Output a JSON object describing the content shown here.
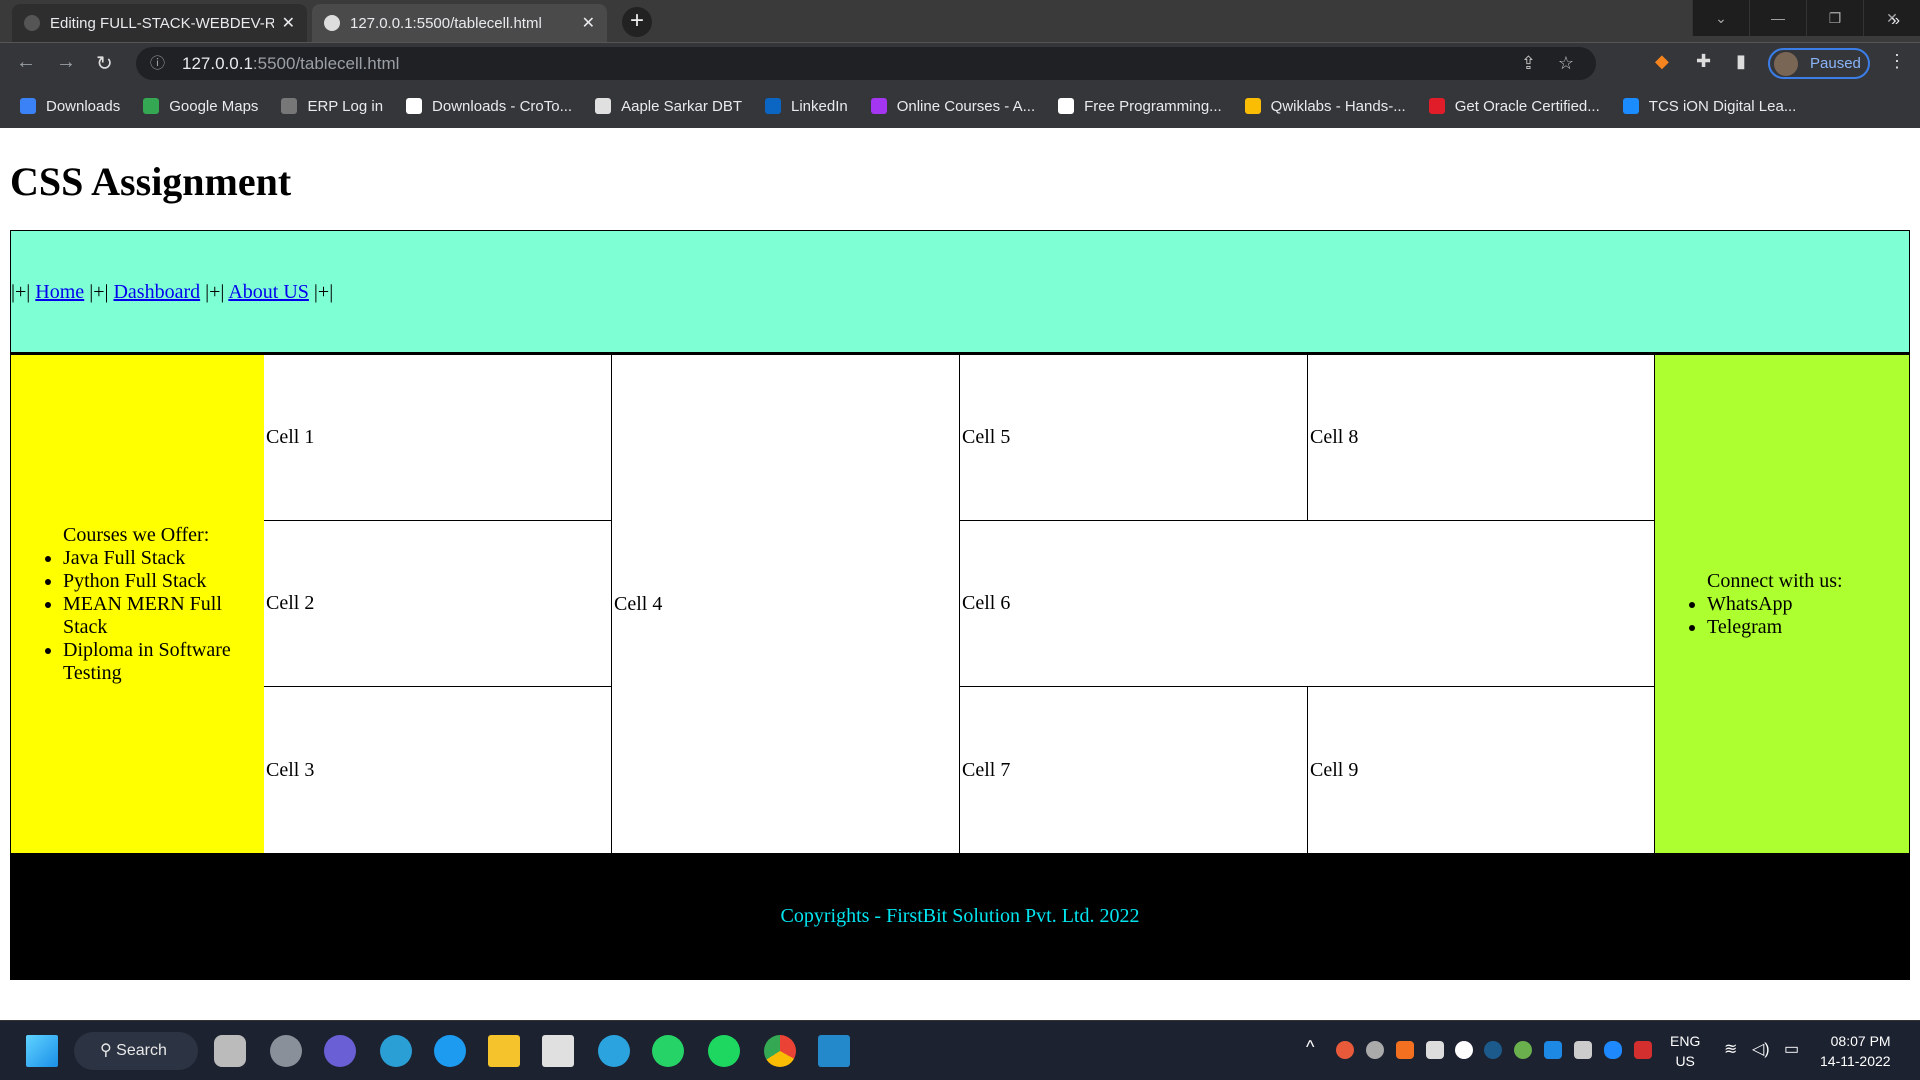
{
  "browser": {
    "tabs": [
      {
        "label": "Editing FULL-STACK-WEBDEV-RE",
        "icon": "github-icon"
      },
      {
        "label": "127.0.0.1:5500/tablecell.html",
        "icon": "globe-icon"
      }
    ],
    "url_host": "127.0.0.1",
    "url_rest": ":5500/tablecell.html",
    "profile_status": "Paused",
    "bookmarks": [
      {
        "label": "Downloads",
        "color": "#3b82f6"
      },
      {
        "label": "Google Maps",
        "color": "#34a853"
      },
      {
        "label": "ERP Log in",
        "color": "#777777"
      },
      {
        "label": "Downloads - CroTo...",
        "color": "#ffffff"
      },
      {
        "label": "Aaple Sarkar DBT",
        "color": "#e0e0e0"
      },
      {
        "label": "LinkedIn",
        "color": "#0a66c2"
      },
      {
        "label": "Online Courses - A...",
        "color": "#a435f0"
      },
      {
        "label": "Free Programming...",
        "color": "#ffffff"
      },
      {
        "label": "Qwiklabs - Hands-...",
        "color": "#fbbc04"
      },
      {
        "label": "Get Oracle Certified...",
        "color": "#e11d2a"
      },
      {
        "label": "TCS iON Digital Lea...",
        "color": "#1a8cff"
      }
    ],
    "more": "»"
  },
  "page": {
    "title": "CSS Assignment",
    "nav": {
      "sep": "|+|",
      "links": [
        "Home",
        "Dashboard",
        "About US"
      ]
    },
    "cells": [
      "Cell 1",
      "Cell 2",
      "Cell 3",
      "Cell 4",
      "Cell 5",
      "Cell 6",
      "Cell 7",
      "Cell 8",
      "Cell 9"
    ],
    "left_aside": {
      "heading": "Courses we Offer:",
      "items": [
        "Java Full Stack",
        "Python Full Stack",
        "MEAN MERN Full Stack",
        "Diploma in Software Testing"
      ]
    },
    "right_aside": {
      "heading": "Connect with us:",
      "items": [
        "WhatsApp",
        "Telegram"
      ]
    },
    "footer": "Copyrights - FirstBit Solution Pvt. Ltd. 2022",
    "colors": {
      "header": "#7fffd4",
      "left_aside": "#ffff00",
      "right_aside": "#adff2f",
      "footer_bg": "#000000",
      "footer_text": "#00e5f0"
    }
  },
  "taskbar": {
    "search": "Search",
    "lang": "ENG",
    "region": "US",
    "time": "08:07 PM",
    "date": "14-11-2022"
  }
}
